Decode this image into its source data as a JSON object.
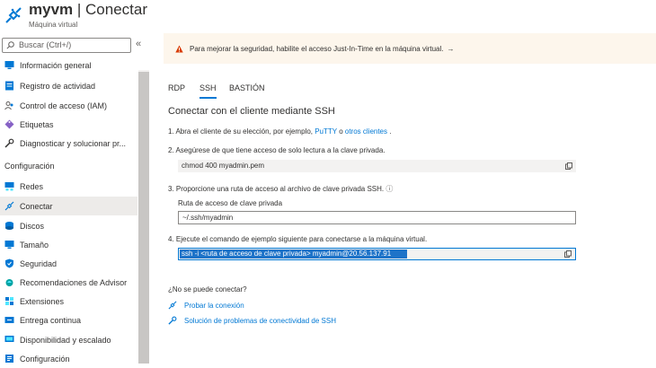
{
  "header": {
    "vm_name": "myvm",
    "separator": " | ",
    "page_title": "Conectar",
    "subtitle": "Máquina virtual"
  },
  "sidebar": {
    "search_placeholder": "Buscar (Ctrl+/)",
    "collapse_label": "«",
    "items": [
      {
        "label": "Información general",
        "icon": "monitor-icon",
        "color": "#0078d4"
      },
      {
        "label": "Registro de actividad",
        "icon": "activity-log-icon",
        "color": "#0078d4"
      },
      {
        "label": "Control de acceso (IAM)",
        "icon": "people-icon",
        "color": "#605e5c"
      },
      {
        "label": "Etiquetas",
        "icon": "tag-icon",
        "color": "#8661c5"
      },
      {
        "label": "Diagnosticar y solucionar pr...",
        "icon": "wrench-icon",
        "color": "#323130"
      }
    ],
    "section_label": "Configuración",
    "config_items": [
      {
        "label": "Redes",
        "icon": "network-icon",
        "color": "#0078d4"
      },
      {
        "label": "Conectar",
        "icon": "connect-icon",
        "color": "#0078d4",
        "active": true
      },
      {
        "label": "Discos",
        "icon": "disk-icon",
        "color": "#0078d4"
      },
      {
        "label": "Tamaño",
        "icon": "monitor-icon",
        "color": "#0078d4"
      },
      {
        "label": "Seguridad",
        "icon": "shield-icon",
        "color": "#0078d4"
      },
      {
        "label": "Recomendaciones de Advisor",
        "icon": "advisor-icon",
        "color": "#00a3a3"
      },
      {
        "label": "Extensiones",
        "icon": "extensions-icon",
        "color": "#0078d4"
      },
      {
        "label": "Entrega continua",
        "icon": "delivery-icon",
        "color": "#0078d4"
      },
      {
        "label": "Disponibilidad y escalado",
        "icon": "availability-icon",
        "color": "#0078d4"
      },
      {
        "label": "Configuración",
        "icon": "config-icon",
        "color": "#0078d4"
      }
    ]
  },
  "banner": {
    "text": "Para mejorar la seguridad, habilite el acceso Just-In-Time en la máquina virtual.",
    "arrow": "→",
    "icon": "warning-icon",
    "color": "#fdf6ec"
  },
  "tabs": [
    "RDP",
    "SSH",
    "BASTIÓN"
  ],
  "active_tab": "SSH",
  "main": {
    "title": "Conectar con el cliente mediante SSH",
    "step1_prefix": "1. Abra el cliente de su elección, por ejemplo, ",
    "step1_putty": "PuTTY",
    "step1_or": " o ",
    "step1_others": "otros clientes",
    "step1_suffix": " .",
    "step2": "2. Asegúrese de que tiene acceso de solo lectura a la clave privada.",
    "step2_cmd": "chmod 400 myadmin.pem",
    "step3": "3. Proporcione una ruta de acceso al archivo de clave privada SSH.",
    "step3_info": "ⓘ",
    "key_path_label": "Ruta de acceso de clave privada",
    "key_path_value": "~/.ssh/myadmin",
    "step4": "4. Ejecute el comando de ejemplo siguiente para conectarse a la máquina virtual.",
    "step4_cmd": "ssh -i <ruta de acceso de clave privada> myadmin@20.56.137.91",
    "cant_connect": "¿No se puede conectar?",
    "help_links": [
      "Probar la conexión",
      "Solución de problemas de conectividad de SSH"
    ]
  },
  "colors": {
    "accent": "#0078d4",
    "selection": "#1e73c8",
    "warning": "#d83b01"
  }
}
